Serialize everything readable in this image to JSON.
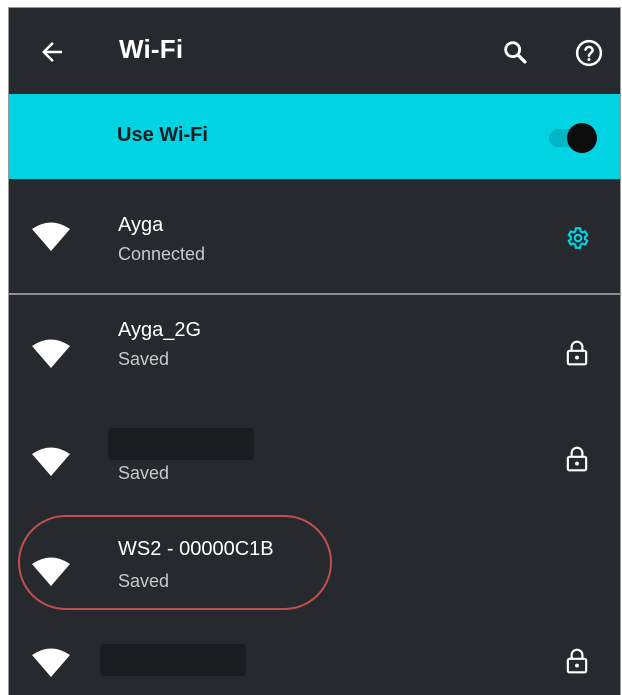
{
  "header": {
    "title": "Wi-Fi",
    "back_icon": "arrow-left-icon",
    "search_icon": "search-icon",
    "help_icon": "help-icon"
  },
  "use_wifi": {
    "label": "Use Wi-Fi",
    "enabled": true
  },
  "networks": [
    {
      "ssid": "Ayga",
      "status": "Connected",
      "action_icon": "gear-icon"
    },
    {
      "ssid": "Ayga_2G",
      "status": "Saved",
      "action_icon": "lock-icon"
    },
    {
      "ssid": "",
      "status": "Saved",
      "action_icon": "lock-icon",
      "ssid_redacted": true
    },
    {
      "ssid": "WS2 - 00000C1B",
      "status": "Saved",
      "action_icon": "",
      "highlighted": true
    },
    {
      "ssid": "",
      "status": "",
      "action_icon": "lock-icon",
      "ssid_redacted": true
    }
  ],
  "colors": {
    "background": "#26292d",
    "accent": "#00d4e3",
    "highlight_outline": "#c0504d"
  }
}
